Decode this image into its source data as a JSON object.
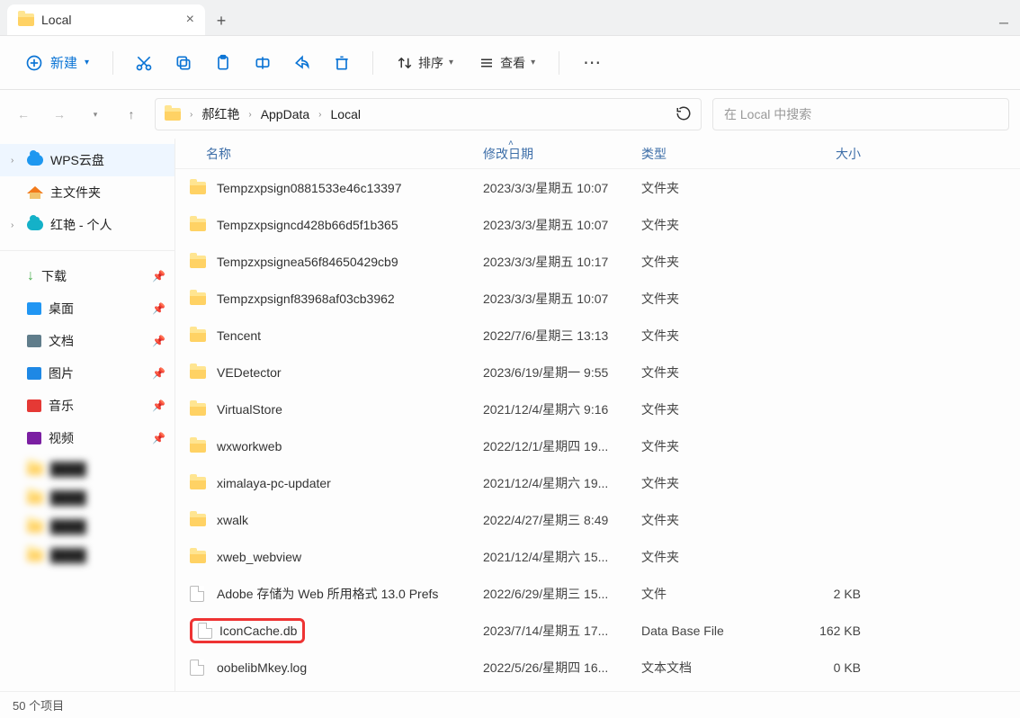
{
  "tab": {
    "title": "Local"
  },
  "toolbar": {
    "new_label": "新建",
    "sort_label": "排序",
    "view_label": "查看"
  },
  "breadcrumb": {
    "items": [
      "郝红艳",
      "AppData",
      "Local"
    ]
  },
  "search": {
    "placeholder": "在 Local 中搜索"
  },
  "sidebar": {
    "wps": "WPS云盘",
    "home": "主文件夹",
    "personal": "红艳 - 个人",
    "quick": {
      "downloads": "下载",
      "desktop": "桌面",
      "documents": "文档",
      "pictures": "图片",
      "music": "音乐",
      "videos": "视频"
    }
  },
  "columns": {
    "name": "名称",
    "date": "修改日期",
    "type": "类型",
    "size": "大小"
  },
  "rows": [
    {
      "kind": "folder",
      "name": "Tempzxpsign0881533e46c13397",
      "date": "2023/3/3/星期五 10:07",
      "type": "文件夹",
      "size": ""
    },
    {
      "kind": "folder",
      "name": "Tempzxpsigncd428b66d5f1b365",
      "date": "2023/3/3/星期五 10:07",
      "type": "文件夹",
      "size": ""
    },
    {
      "kind": "folder",
      "name": "Tempzxpsignea56f84650429cb9",
      "date": "2023/3/3/星期五 10:17",
      "type": "文件夹",
      "size": ""
    },
    {
      "kind": "folder",
      "name": "Tempzxpsignf83968af03cb3962",
      "date": "2023/3/3/星期五 10:07",
      "type": "文件夹",
      "size": ""
    },
    {
      "kind": "folder",
      "name": "Tencent",
      "date": "2022/7/6/星期三 13:13",
      "type": "文件夹",
      "size": ""
    },
    {
      "kind": "folder",
      "name": "VEDetector",
      "date": "2023/6/19/星期一 9:55",
      "type": "文件夹",
      "size": ""
    },
    {
      "kind": "folder",
      "name": "VirtualStore",
      "date": "2021/12/4/星期六 9:16",
      "type": "文件夹",
      "size": ""
    },
    {
      "kind": "folder",
      "name": "wxworkweb",
      "date": "2022/12/1/星期四 19...",
      "type": "文件夹",
      "size": ""
    },
    {
      "kind": "folder",
      "name": "ximalaya-pc-updater",
      "date": "2021/12/4/星期六 19...",
      "type": "文件夹",
      "size": ""
    },
    {
      "kind": "folder",
      "name": "xwalk",
      "date": "2022/4/27/星期三 8:49",
      "type": "文件夹",
      "size": ""
    },
    {
      "kind": "folder",
      "name": "xweb_webview",
      "date": "2021/12/4/星期六 15...",
      "type": "文件夹",
      "size": ""
    },
    {
      "kind": "file",
      "name": "Adobe 存储为 Web 所用格式 13.0 Prefs",
      "date": "2022/6/29/星期三 15...",
      "type": "文件",
      "size": "2 KB"
    },
    {
      "kind": "file",
      "name": "IconCache.db",
      "date": "2023/7/14/星期五 17...",
      "type": "Data Base File",
      "size": "162 KB",
      "hl": true
    },
    {
      "kind": "file",
      "name": "oobelibMkey.log",
      "date": "2022/5/26/星期四 16...",
      "type": "文本文档",
      "size": "0 KB"
    }
  ],
  "status": {
    "text": "50 个项目"
  }
}
